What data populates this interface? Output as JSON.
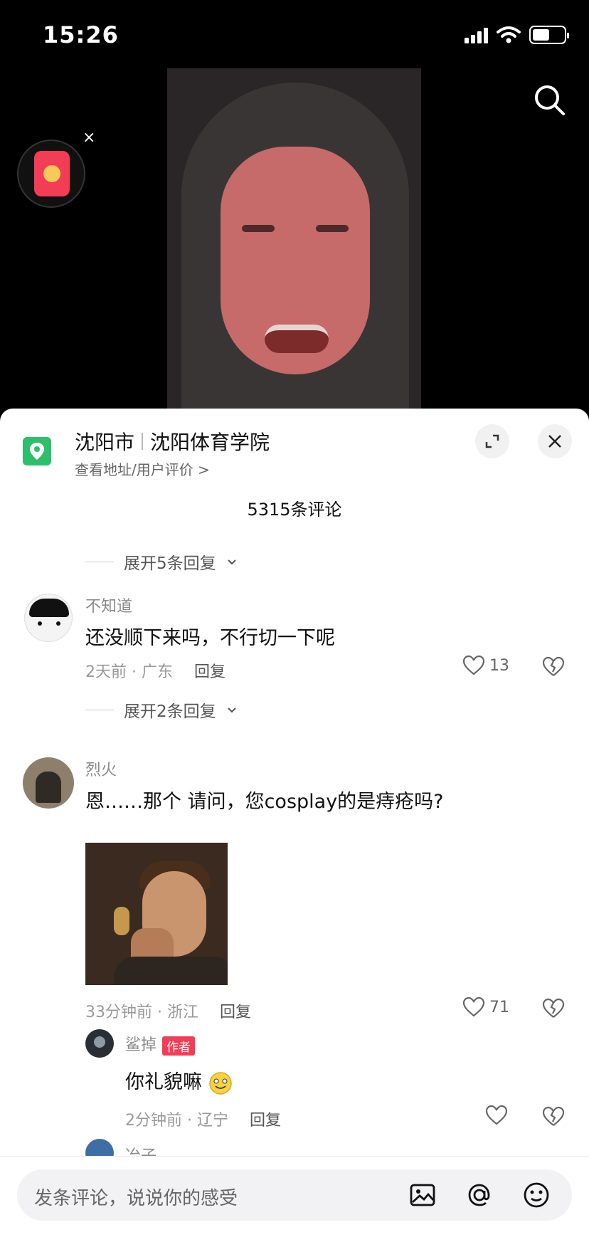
{
  "status": {
    "time": "15:26"
  },
  "redpacket": {
    "close_label": "×"
  },
  "location": {
    "city": "沈阳市",
    "place": "沈阳体育学院",
    "subtitle": "查看地址/用户评价 >"
  },
  "comments_header": {
    "count_text": "5315条评论"
  },
  "expand_top": {
    "label": "展开5条回复"
  },
  "comments": [
    {
      "user": "不知道",
      "text": "还没顺下来吗，不行切一下呢",
      "meta": "2天前 · 广东",
      "reply_label": "回复",
      "likes": "13",
      "expand_label": "展开2条回复"
    },
    {
      "user": "烈火",
      "text": "恩……那个 请问，您cosplay的是痔疮吗?",
      "meta": "33分钟前 · 浙江",
      "reply_label": "回复",
      "likes": "71"
    }
  ],
  "reply": {
    "user": "鲨掉",
    "badge": "作者",
    "text": "你礼貌嘛",
    "meta": "2分钟前 · 辽宁",
    "reply_label": "回复",
    "likes": ""
  },
  "next_comment": {
    "user": "冶子"
  },
  "input": {
    "placeholder": "发条评论，说说你的感受"
  },
  "colors": {
    "accent": "#f33c55",
    "location_green": "#2ebf6d"
  }
}
